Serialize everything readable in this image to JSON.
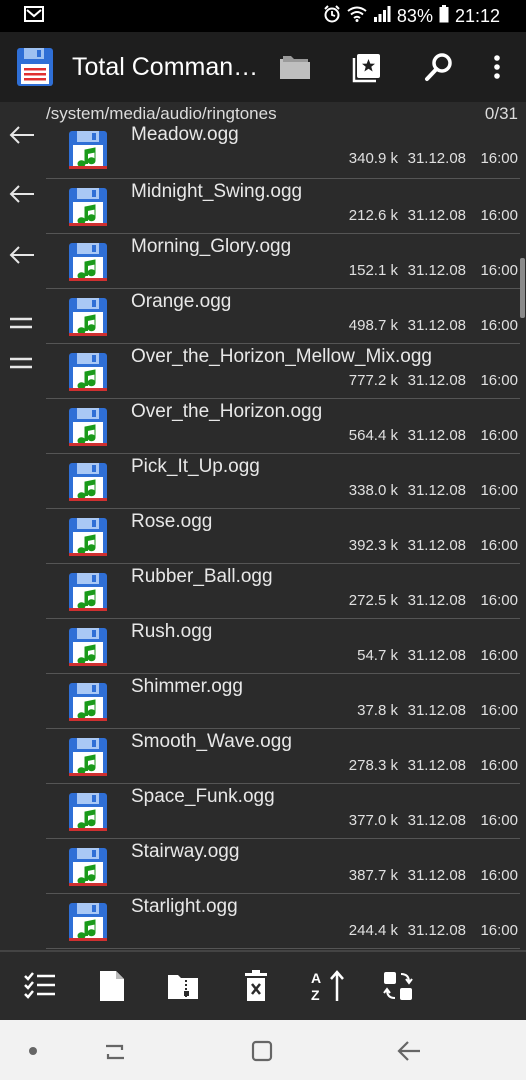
{
  "status_bar": {
    "battery": "83%",
    "time": "21:12"
  },
  "app_bar": {
    "title": "Total Comman…"
  },
  "path_bar": {
    "path": "/system/media/audio/ringtones",
    "selection_count": "0/31"
  },
  "files": [
    {
      "name": "Meadow.ogg",
      "size": "340.9 k",
      "date": "31.12.08",
      "time": "16:00"
    },
    {
      "name": "Midnight_Swing.ogg",
      "size": "212.6 k",
      "date": "31.12.08",
      "time": "16:00"
    },
    {
      "name": "Morning_Glory.ogg",
      "size": "152.1 k",
      "date": "31.12.08",
      "time": "16:00"
    },
    {
      "name": "Orange.ogg",
      "size": "498.7 k",
      "date": "31.12.08",
      "time": "16:00"
    },
    {
      "name": "Over_the_Horizon_Mellow_Mix.ogg",
      "size": "777.2 k",
      "date": "31.12.08",
      "time": "16:00"
    },
    {
      "name": "Over_the_Horizon.ogg",
      "size": "564.4 k",
      "date": "31.12.08",
      "time": "16:00"
    },
    {
      "name": "Pick_It_Up.ogg",
      "size": "338.0 k",
      "date": "31.12.08",
      "time": "16:00"
    },
    {
      "name": "Rose.ogg",
      "size": "392.3 k",
      "date": "31.12.08",
      "time": "16:00"
    },
    {
      "name": "Rubber_Ball.ogg",
      "size": "272.5 k",
      "date": "31.12.08",
      "time": "16:00"
    },
    {
      "name": "Rush.ogg",
      "size": "54.7 k",
      "date": "31.12.08",
      "time": "16:00"
    },
    {
      "name": "Shimmer.ogg",
      "size": "37.8 k",
      "date": "31.12.08",
      "time": "16:00"
    },
    {
      "name": "Smooth_Wave.ogg",
      "size": "278.3 k",
      "date": "31.12.08",
      "time": "16:00"
    },
    {
      "name": "Space_Funk.ogg",
      "size": "377.0 k",
      "date": "31.12.08",
      "time": "16:00"
    },
    {
      "name": "Stairway.ogg",
      "size": "387.7 k",
      "date": "31.12.08",
      "time": "16:00"
    },
    {
      "name": "Starlight.ogg",
      "size": "244.4 k",
      "date": "31.12.08",
      "time": "16:00"
    }
  ],
  "toolbar": {
    "icons": [
      "select-multiple-icon",
      "new-file-icon",
      "zip-folder-icon",
      "delete-icon",
      "sort-icon",
      "swap-panels-icon"
    ]
  },
  "colors": {
    "background": "#2b2b2b",
    "app_bar": "#1e1e1e",
    "floppy_blue": "#2f6fd6",
    "note_green": "#1a9a1a"
  }
}
